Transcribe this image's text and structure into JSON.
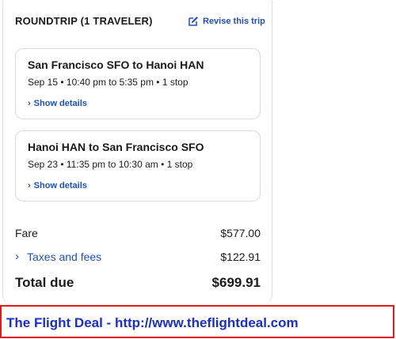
{
  "header": {
    "title": "ROUNDTRIP (1 TRAVELER)",
    "revise_label": "Revise this trip"
  },
  "legs": [
    {
      "route": "San Francisco SFO to Hanoi HAN",
      "times": "Sep 15 • 10:40 pm to 5:35 pm • 1 stop",
      "details_label": "Show details"
    },
    {
      "route": "Hanoi HAN to San Francisco SFO",
      "times": "Sep 23 • 11:35 pm to 10:30 am • 1 stop",
      "details_label": "Show details"
    }
  ],
  "pricing": {
    "fare_label": "Fare",
    "fare_value": "$577.00",
    "taxes_label": "Taxes and fees",
    "taxes_value": "$122.91",
    "total_label": "Total due",
    "total_value": "$699.91"
  },
  "banner": {
    "text": "The Flight Deal - http://www.theflightdeal.com"
  },
  "icons": {
    "revise": "edit-icon",
    "details": "chevron-right-icon"
  },
  "colors": {
    "link": "#1f4fc4",
    "banner_border": "#e31b1b",
    "banner_text": "#1a2fc8"
  }
}
